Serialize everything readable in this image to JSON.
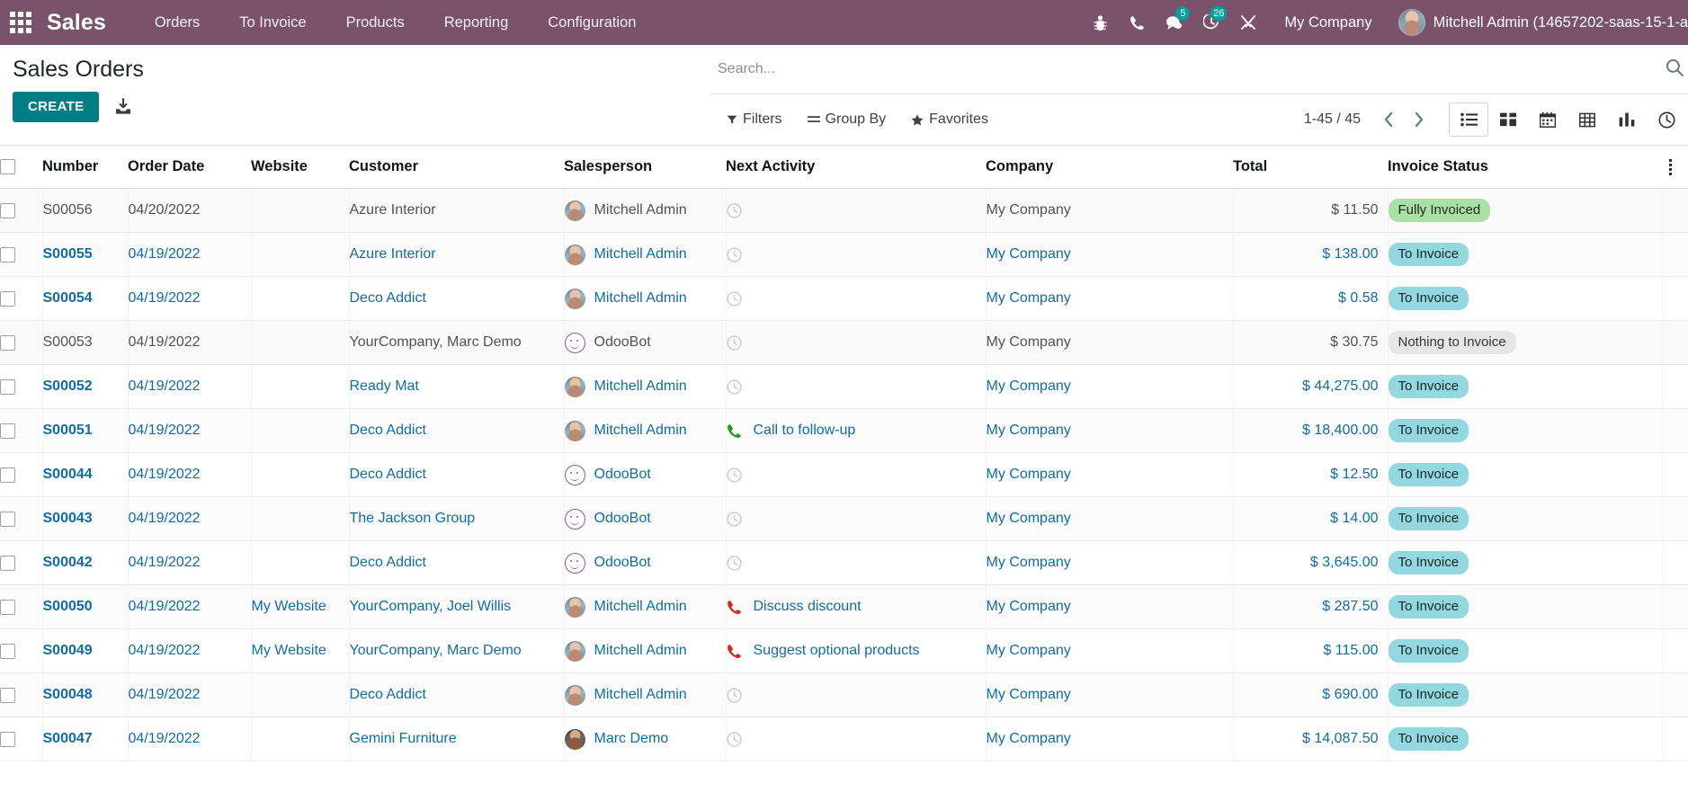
{
  "navbar": {
    "apps_icon": "apps-grid-icon",
    "brand": "Sales",
    "menu": [
      {
        "label": "Orders"
      },
      {
        "label": "To Invoice"
      },
      {
        "label": "Products"
      },
      {
        "label": "Reporting"
      },
      {
        "label": "Configuration"
      }
    ],
    "icons": [
      {
        "name": "bug-icon",
        "badge": ""
      },
      {
        "name": "phone-icon",
        "badge": ""
      },
      {
        "name": "messages-icon",
        "badge": "5"
      },
      {
        "name": "activities-clock-icon",
        "badge": "26"
      },
      {
        "name": "tools-icon",
        "badge": ""
      }
    ],
    "company": "My Company",
    "user_name": "Mitchell Admin (14657202-saas-15-1-a",
    "badge_color": "#00a09d",
    "bg_color": "#7a526b"
  },
  "control_panel": {
    "title": "Sales Orders",
    "create_label": "CREATE",
    "upload_icon": "upload-import-icon",
    "search_placeholder": "Search...",
    "search_value": "",
    "filters_label": "Filters",
    "group_by_label": "Group By",
    "favorites_label": "Favorites",
    "pager": "1-45 / 45",
    "prev_icon": "chevron-left-icon",
    "next_icon": "chevron-right-icon",
    "views": [
      {
        "name": "list-view",
        "icon": "list-icon",
        "active": true
      },
      {
        "name": "kanban-view",
        "icon": "kanban-icon",
        "active": false
      },
      {
        "name": "calendar-view",
        "icon": "calendar-icon",
        "active": false
      },
      {
        "name": "pivot-view",
        "icon": "pivot-grid-icon",
        "active": false
      },
      {
        "name": "graph-view",
        "icon": "bar-chart-icon",
        "active": false
      },
      {
        "name": "activity-view",
        "icon": "clock-icon",
        "active": false
      }
    ]
  },
  "table": {
    "columns": [
      "Number",
      "Order Date",
      "Website",
      "Customer",
      "Salesperson",
      "Next Activity",
      "Company",
      "Total",
      "Invoice Status"
    ],
    "rows": [
      {
        "number": "S00056",
        "date": "04/20/2022",
        "website": "",
        "customer": "Azure Interior",
        "salesperson": "Mitchell Admin",
        "avatar": "mitchell",
        "activity": "",
        "activity_icon": "clock-icon",
        "company": "My Company",
        "total": "$ 11.50",
        "status": "Fully Invoiced",
        "status_color": "green",
        "visited": true
      },
      {
        "number": "S00055",
        "date": "04/19/2022",
        "website": "",
        "customer": "Azure Interior",
        "salesperson": "Mitchell Admin",
        "avatar": "mitchell",
        "activity": "",
        "activity_icon": "clock-icon",
        "company": "My Company",
        "total": "$ 138.00",
        "status": "To Invoice",
        "status_color": "cyan",
        "visited": false
      },
      {
        "number": "S00054",
        "date": "04/19/2022",
        "website": "",
        "customer": "Deco Addict",
        "salesperson": "Mitchell Admin",
        "avatar": "mitchell",
        "activity": "",
        "activity_icon": "clock-icon",
        "company": "My Company",
        "total": "$ 0.58",
        "status": "To Invoice",
        "status_color": "cyan",
        "visited": false
      },
      {
        "number": "S00053",
        "date": "04/19/2022",
        "website": "",
        "customer": "YourCompany, Marc Demo",
        "salesperson": "OdooBot",
        "avatar": "bot",
        "activity": "",
        "activity_icon": "clock-icon",
        "company": "My Company",
        "total": "$ 30.75",
        "status": "Nothing to Invoice",
        "status_color": "grey",
        "visited": true
      },
      {
        "number": "S00052",
        "date": "04/19/2022",
        "website": "",
        "customer": "Ready Mat",
        "salesperson": "Mitchell Admin",
        "avatar": "mitchell",
        "activity": "",
        "activity_icon": "clock-icon",
        "company": "My Company",
        "total": "$ 44,275.00",
        "status": "To Invoice",
        "status_color": "cyan",
        "visited": false
      },
      {
        "number": "S00051",
        "date": "04/19/2022",
        "website": "",
        "customer": "Deco Addict",
        "salesperson": "Mitchell Admin",
        "avatar": "mitchell",
        "activity": "Call to follow-up",
        "activity_icon": "phone-green-icon",
        "company": "My Company",
        "total": "$ 18,400.00",
        "status": "To Invoice",
        "status_color": "cyan",
        "visited": false
      },
      {
        "number": "S00044",
        "date": "04/19/2022",
        "website": "",
        "customer": "Deco Addict",
        "salesperson": "OdooBot",
        "avatar": "bot",
        "activity": "",
        "activity_icon": "clock-icon",
        "company": "My Company",
        "total": "$ 12.50",
        "status": "To Invoice",
        "status_color": "cyan",
        "visited": false
      },
      {
        "number": "S00043",
        "date": "04/19/2022",
        "website": "",
        "customer": "The Jackson Group",
        "salesperson": "OdooBot",
        "avatar": "bot",
        "activity": "",
        "activity_icon": "clock-icon",
        "company": "My Company",
        "total": "$ 14.00",
        "status": "To Invoice",
        "status_color": "cyan",
        "visited": false
      },
      {
        "number": "S00042",
        "date": "04/19/2022",
        "website": "",
        "customer": "Deco Addict",
        "salesperson": "OdooBot",
        "avatar": "bot",
        "activity": "",
        "activity_icon": "clock-icon",
        "company": "My Company",
        "total": "$ 3,645.00",
        "status": "To Invoice",
        "status_color": "cyan",
        "visited": false
      },
      {
        "number": "S00050",
        "date": "04/19/2022",
        "website": "My Website",
        "customer": "YourCompany, Joel Willis",
        "salesperson": "Mitchell Admin",
        "avatar": "mitchell",
        "activity": "Discuss discount",
        "activity_icon": "phone-red-icon",
        "company": "My Company",
        "total": "$ 287.50",
        "status": "To Invoice",
        "status_color": "cyan",
        "visited": false
      },
      {
        "number": "S00049",
        "date": "04/19/2022",
        "website": "My Website",
        "customer": "YourCompany, Marc Demo",
        "salesperson": "Mitchell Admin",
        "avatar": "mitchell",
        "activity": "Suggest optional products",
        "activity_icon": "phone-red-icon",
        "company": "My Company",
        "total": "$ 115.00",
        "status": "To Invoice",
        "status_color": "cyan",
        "visited": false
      },
      {
        "number": "S00048",
        "date": "04/19/2022",
        "website": "",
        "customer": "Deco Addict",
        "salesperson": "Mitchell Admin",
        "avatar": "mitchell",
        "activity": "",
        "activity_icon": "clock-icon",
        "company": "My Company",
        "total": "$ 690.00",
        "status": "To Invoice",
        "status_color": "cyan",
        "visited": false
      },
      {
        "number": "S00047",
        "date": "04/19/2022",
        "website": "",
        "customer": "Gemini Furniture",
        "salesperson": "Marc Demo",
        "avatar": "marc",
        "activity": "",
        "activity_icon": "clock-icon",
        "company": "My Company",
        "total": "$ 14,087.50",
        "status": "To Invoice",
        "status_color": "cyan",
        "visited": false
      }
    ]
  },
  "colors": {
    "brand_purple": "#7a526b",
    "teal": "#017e84",
    "link_blue": "#0e6ca8",
    "badge_green": "#aadfa6",
    "badge_cyan": "#92d8de",
    "badge_grey": "#e6e6e6"
  }
}
